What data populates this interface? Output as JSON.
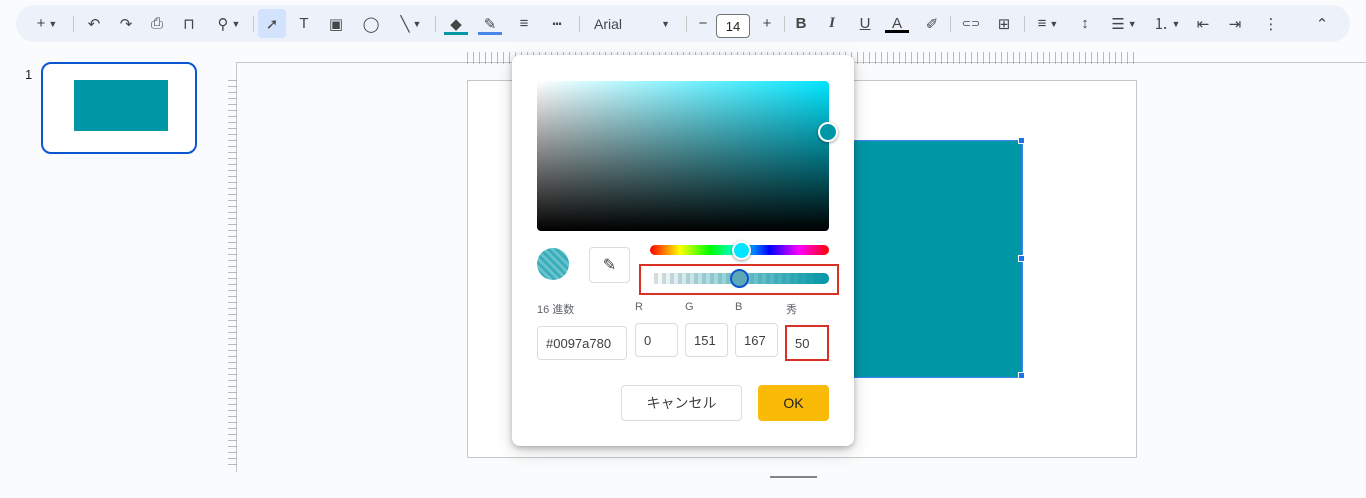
{
  "toolbar": {
    "add": "+",
    "undo": "↶",
    "redo": "↷",
    "print": "⎙",
    "paint_format": "⊓",
    "zoom": "⚲",
    "select": "➚",
    "textbox": "T",
    "image": "▣",
    "shape": "◯",
    "line": "╲",
    "fill": "◆",
    "border": "✎",
    "border_weight": "≡",
    "border_dash": "┅",
    "font": "Arial",
    "minus": "−",
    "font_size": "14",
    "plus": "+",
    "bold": "B",
    "italic": "I",
    "underline": "U",
    "text_color": "A",
    "highlight": "✐",
    "link": "⊂⊃",
    "comment": "⊞",
    "align": "≡",
    "line_spacing": "↕",
    "bullets": "☰",
    "numbered": "⒈",
    "indent_less": "⇤",
    "indent_more": "⇥",
    "more": "⋮",
    "collapse": "⌃",
    "fill_color": "#0097a7",
    "border_color": "#4a86e8",
    "text_color_bar": "#000000"
  },
  "filmstrip": {
    "slide_number": "1"
  },
  "picker": {
    "hex_label": "16 進数",
    "r_label": "R",
    "g_label": "G",
    "b_label": "B",
    "a_label": "秀",
    "hex_value": "#0097a780",
    "r_value": "0",
    "g_value": "151",
    "b_value": "167",
    "a_value": "50",
    "hue_fraction": 0.51,
    "alpha_fraction": 0.5,
    "eyedropper_icon": "✎",
    "cancel": "キャンセル",
    "ok": "OK"
  },
  "colors": {
    "shape": "#0097a7",
    "accent": "#0b57d0",
    "ok_button": "#f9bb08",
    "highlight_box": "#d93025"
  }
}
